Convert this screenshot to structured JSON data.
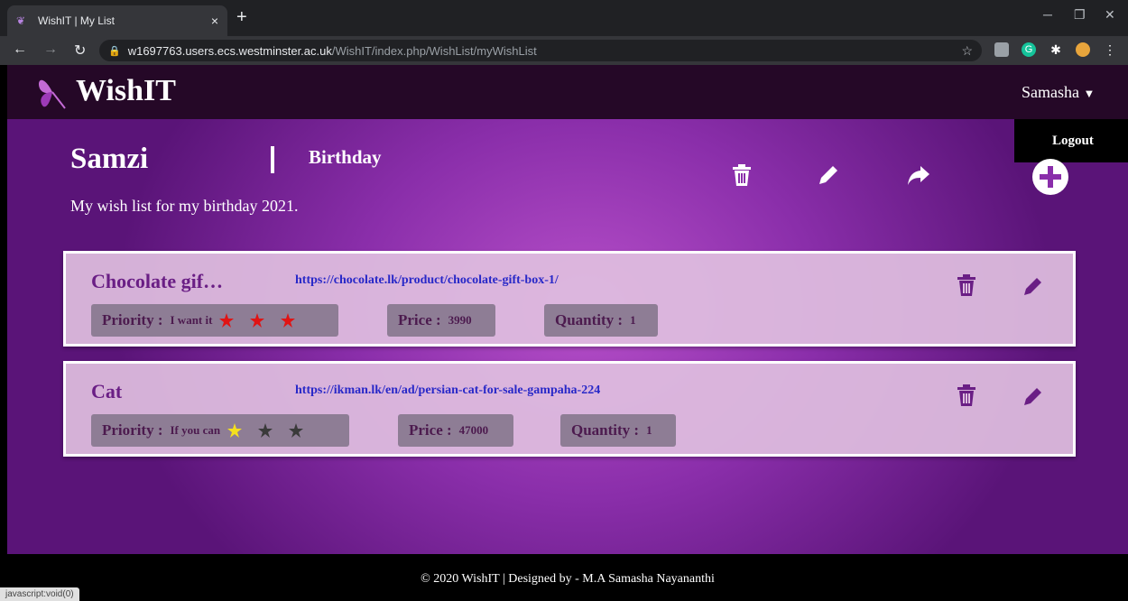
{
  "browser": {
    "tab_title": "WishIT | My List",
    "tab_close": "×",
    "new_tab": "+",
    "url_host": "w1697763.users.ecs.westminster.ac.uk",
    "url_path": "/WishIT/index.php/WishList/myWishList",
    "status_text": "javascript:void(0)"
  },
  "header": {
    "brand": "WishIT",
    "user": "Samasha",
    "dropdown_logout": "Logout"
  },
  "wishlist": {
    "name": "Samzi",
    "occasion": "Birthday",
    "description": "My wish list for my birthday 2021."
  },
  "items": [
    {
      "name": "Chocolate gif…",
      "url": "https://chocolate.lk/product/chocolate-gift-box-1/",
      "priority_label": "Priority :",
      "priority_value": "I want it",
      "priority_stars": 3,
      "price_label": "Price :",
      "price_value": "3990",
      "quantity_label": "Quantity :",
      "quantity_value": "1",
      "star_color": "#e01414"
    },
    {
      "name": "Cat",
      "url": "https://ikman.lk/en/ad/persian-cat-for-sale-gampaha-224",
      "priority_label": "Priority :",
      "priority_value": "If you can",
      "priority_stars": 1,
      "price_label": "Price :",
      "price_value": "47000",
      "quantity_label": "Quantity :",
      "quantity_value": "1",
      "star_color": "#f5e01e"
    }
  ],
  "footer": {
    "text": "© 2020 WishIT | Designed by - M.A Samasha Nayananthi"
  },
  "colors": {
    "header_bg": "#250827",
    "accent_purple": "#6a1e85",
    "link_blue": "#2828c8",
    "chip_bg": "#8e7d95",
    "empty_star": "#3a3a3a"
  }
}
